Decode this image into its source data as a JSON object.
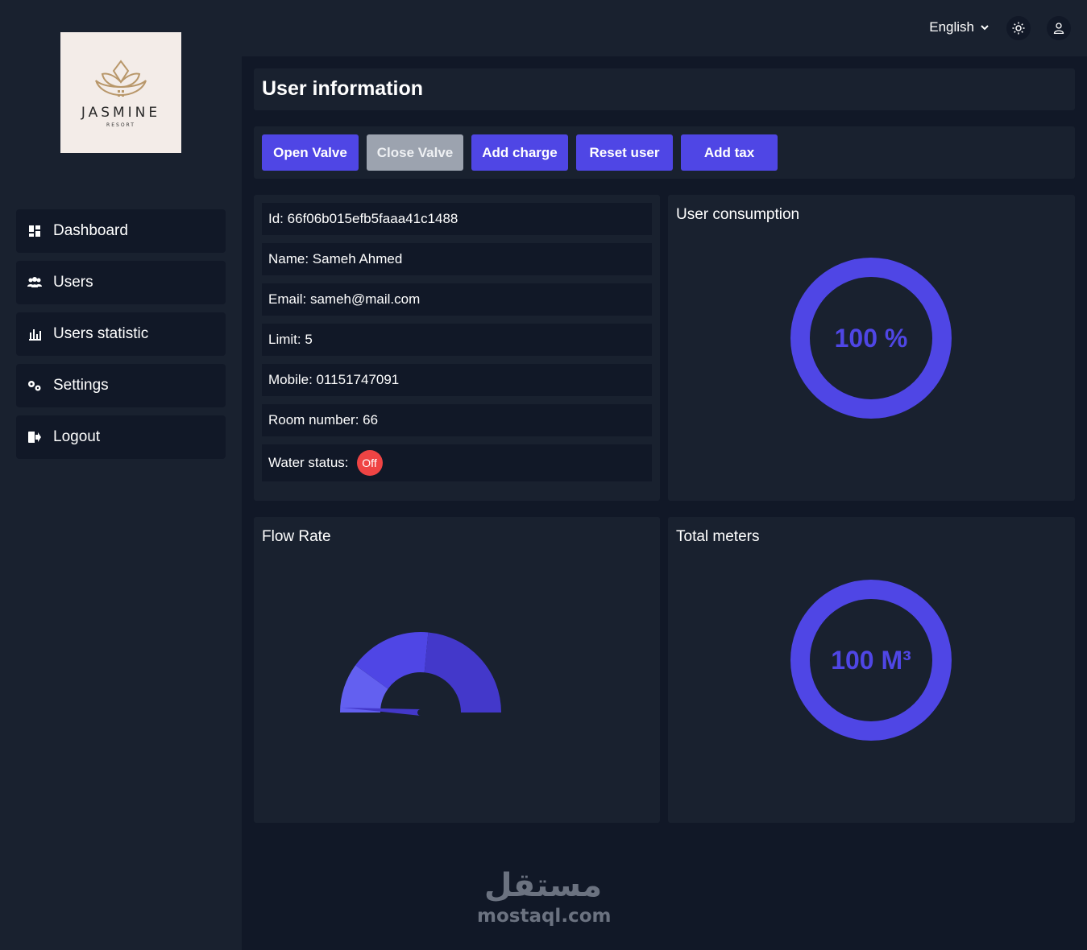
{
  "logo": {
    "name": "JASMINE",
    "tagline": "RESORT"
  },
  "sidebar": {
    "items": [
      {
        "label": "Dashboard",
        "icon": "dashboard-icon"
      },
      {
        "label": "Users",
        "icon": "users-icon"
      },
      {
        "label": "Users statistic",
        "icon": "bar-chart-icon"
      },
      {
        "label": "Settings",
        "icon": "gears-icon"
      },
      {
        "label": "Logout",
        "icon": "logout-icon"
      }
    ]
  },
  "topbar": {
    "language": "English",
    "theme_icon": "sun-icon",
    "profile_icon": "user-icon"
  },
  "page": {
    "title": "User information"
  },
  "actions": {
    "open_valve": "Open Valve",
    "close_valve": "Close Valve",
    "add_charge": "Add charge",
    "reset_user": "Reset user",
    "add_tax": "Add tax"
  },
  "user": {
    "id": "Id: 66f06b015efb5faaa41c1488",
    "name": "Name: Sameh Ahmed",
    "email": "Email: sameh@mail.com",
    "limit": "Limit: 5",
    "mobile": "Mobile: 01151747091",
    "room": "Room number: 66",
    "water_status_label": "Water status:",
    "water_status_value": "Off"
  },
  "consumption": {
    "title": "User consumption",
    "value_text": "100 %",
    "fraction": 1.0
  },
  "flow_rate": {
    "title": "Flow Rate",
    "segments": [
      0.2,
      0.33,
      0.47
    ],
    "needle_fraction": 0.02
  },
  "total_meters": {
    "title": "Total meters",
    "value_text": "100 M³",
    "fraction": 1.0
  },
  "colors": {
    "accent": "#4f46e5",
    "ring": "#4f46e5",
    "ring_text": "#4f46e5",
    "gauge_seg1": "#6360f0",
    "gauge_seg2": "#4f46e5",
    "gauge_seg3": "#4338ca",
    "status_off": "#ef4444"
  },
  "watermark": {
    "arabic": "مستقل",
    "latin": "mostaql.com"
  }
}
